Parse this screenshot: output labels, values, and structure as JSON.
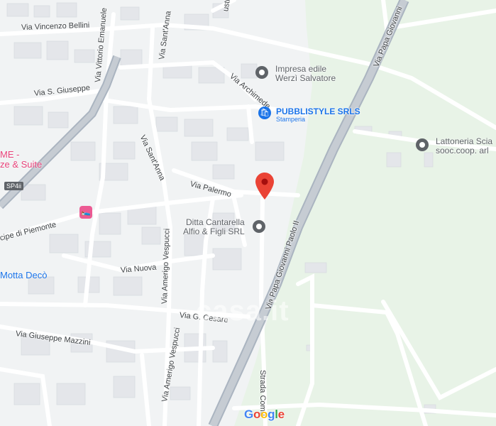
{
  "map": {
    "streets": {
      "via_vincenzo_bellini": "Via Vincenzo Bellini",
      "via_vittorio_emanuele": "Via Vittorio Emanuele",
      "via_sant_anna_top": "Via Sant'Anna",
      "via_s_giuseppe": "Via S. Giuseppe",
      "via_archimede": "Via Archimede",
      "via_sant_anna": "Via Sant'Anna",
      "via_palermo": "Via Palermo",
      "via_amerigo_vespucci": "Via Amerigo Vespucci",
      "via_principe_di_piemonte": "cipe di Piemonte",
      "via_nuova": "Via Nuova",
      "via_g_cesare": "Via G. Cesare",
      "via_giuseppe_mazzini": "Via Giuseppe Mazzini",
      "via_amerigo_vespucci_lower": "Via Amerigo Vespucci",
      "via_papa_giovanni_upper": "Via Papa Giovanni",
      "via_papa_giovanni_paolo_ii": "Via Papa Giovanni Paolo II",
      "strada_comunale": "Strada Comu",
      "top_partial": "usti"
    },
    "places": {
      "impresa": "Impresa edile\nWerzì Salvatore",
      "pubblistyle": "PUBBLISTYLE SRLS",
      "pubblistyle_sub": "Stamperia",
      "lattoneria": "Lattoneria Scia\nsooc.coop. arl",
      "cantarella": "Ditta Cantarella\nAlfio & Figli SRL",
      "hotel_partial_1": "ME -",
      "hotel_partial_2": "ze & Suite",
      "motta": "Motta Decò"
    },
    "route_badge": "SP4ii",
    "watermark": "casa.it",
    "logo": {
      "letters": [
        "G",
        "o",
        "o",
        "g",
        "l",
        "e"
      ],
      "colors": [
        "#4285f4",
        "#ea4335",
        "#fbbc05",
        "#4285f4",
        "#34a853",
        "#ea4335"
      ]
    },
    "colors": {
      "park_green": "#e8f3e7",
      "background": "#f1f3f4",
      "road": "#ffffff",
      "highway": "#aab4c0",
      "marker_red": "#ea4335"
    }
  }
}
